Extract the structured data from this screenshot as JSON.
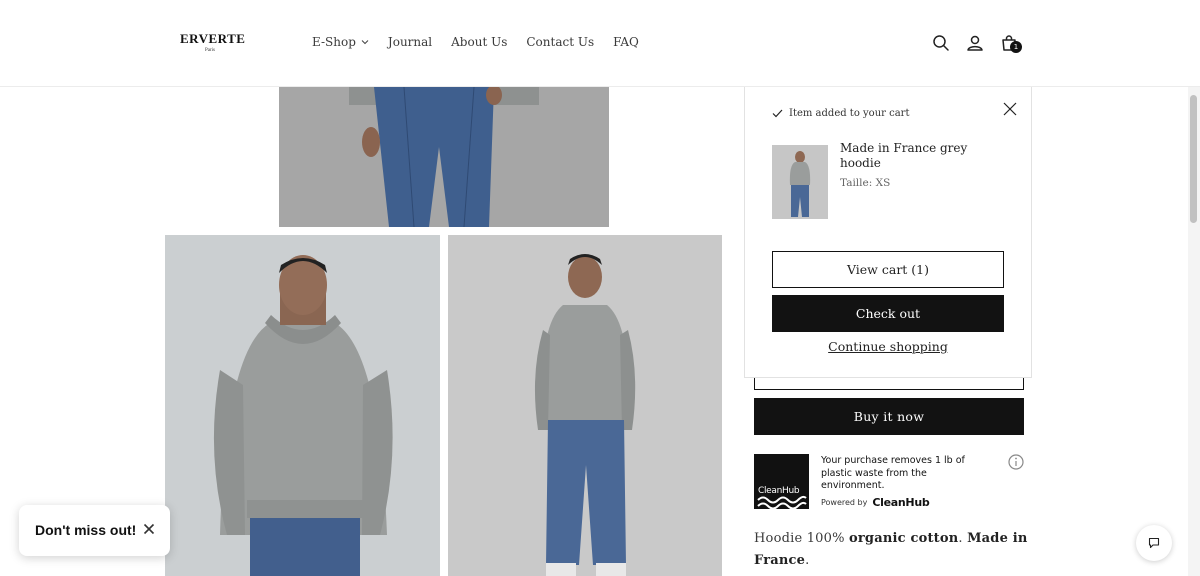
{
  "header": {
    "logo_main": "ERVERTE",
    "logo_sub": "Paris",
    "nav": [
      {
        "label": "E-Shop",
        "has_dropdown": true
      },
      {
        "label": "Journal"
      },
      {
        "label": "About Us"
      },
      {
        "label": "Contact Us"
      },
      {
        "label": "FAQ"
      }
    ],
    "icons": [
      "search-icon",
      "account-icon",
      "cart-icon"
    ],
    "cart_count": "1"
  },
  "cart_popup": {
    "added_message": "Item added to your cart",
    "product_name": "Made in France grey hoodie",
    "variant": "Taille: XS",
    "view_cart": "View cart (1)",
    "checkout": "Check out",
    "continue": "Continue shopping"
  },
  "product": {
    "buy_now": "Buy it now",
    "cleanhub": {
      "logo_text": "CleanHub",
      "message": "Your purchase removes 1 lb of plastic waste from the environment.",
      "powered_by": "Powered by",
      "brand": "CleanHub"
    },
    "description_parts": [
      "Hoodie 100% ",
      "organic cotton",
      ". ",
      "Made in France",
      "."
    ]
  },
  "popup_banner": {
    "text": "Don't miss out!"
  },
  "colors": {
    "primary": "#121212",
    "background": "#ffffff"
  }
}
